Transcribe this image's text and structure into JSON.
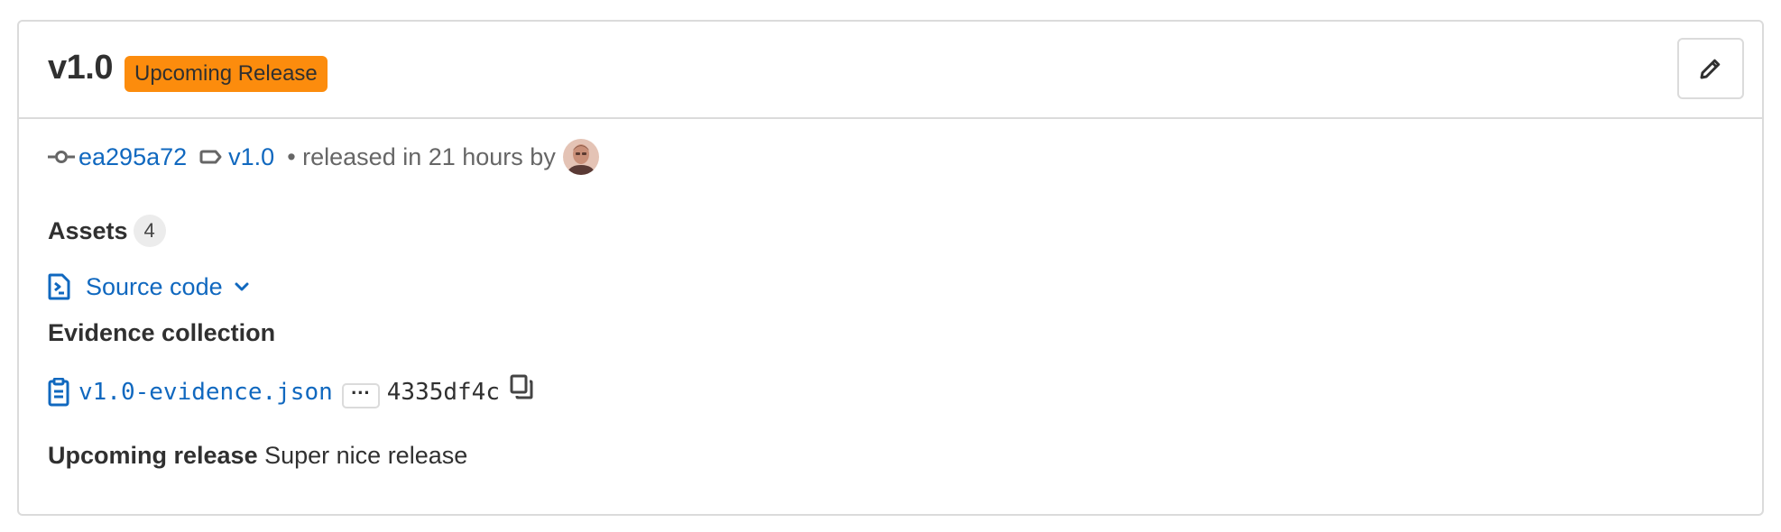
{
  "release": {
    "title": "v1.0",
    "status_badge": "Upcoming Release",
    "edit_icon": "pencil-icon"
  },
  "meta": {
    "commit_icon": "commit-icon",
    "commit_sha": "ea295a72",
    "tag_icon": "tag-icon",
    "tag_name": "v1.0",
    "released_text": "• released in 21 hours by",
    "author_avatar": "avatar"
  },
  "assets": {
    "heading": "Assets",
    "count": "4",
    "source_code_icon": "doc-code-icon",
    "source_code_label": "Source code",
    "chevron_icon": "chevron-down-icon"
  },
  "evidence": {
    "heading": "Evidence collection",
    "clipboard_icon": "clipboard-icon",
    "file_name": "v1.0-evidence.json",
    "ellipsis": "...",
    "sha": "4335df4c",
    "copy_icon": "copy-icon"
  },
  "notes": {
    "label": "Upcoming release",
    "text": "Super nice release"
  },
  "colors": {
    "link": "#1068bf",
    "badge_orange": "#fc8c0d",
    "border": "#dbdbdb",
    "text": "#303030",
    "muted": "#666666"
  }
}
